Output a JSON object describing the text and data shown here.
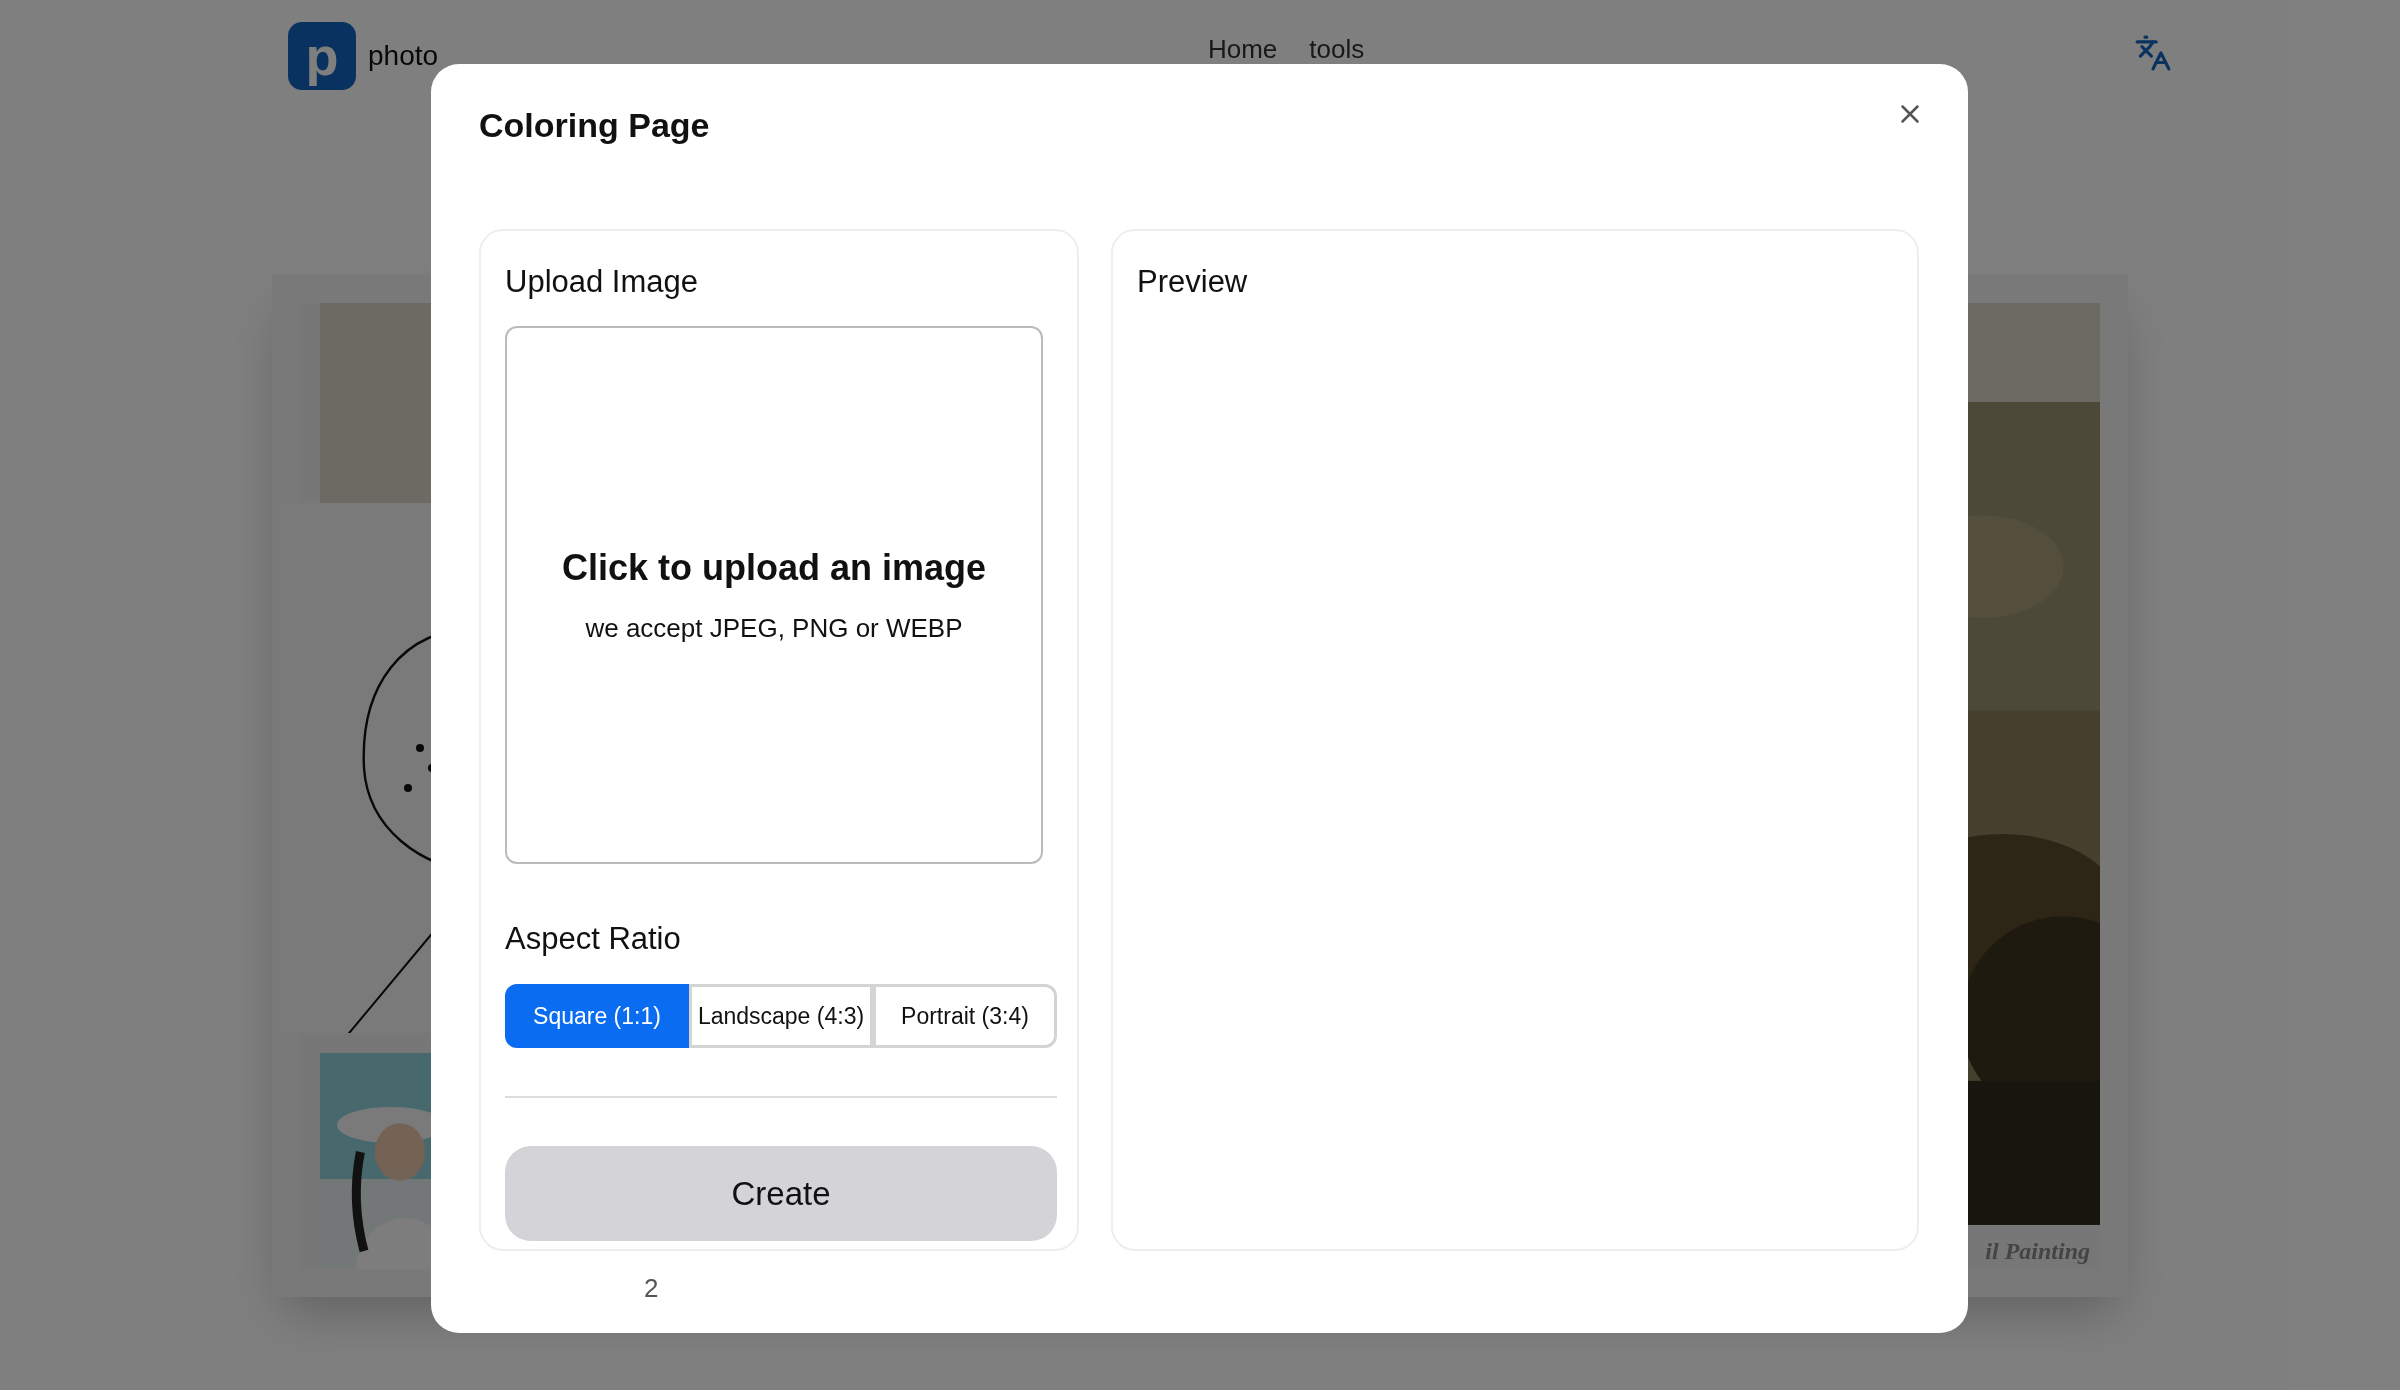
{
  "header": {
    "logo_letter": "p",
    "site_name": "photo",
    "nav": [
      "Home",
      "tools"
    ]
  },
  "gallery": {
    "caption": "il Painting"
  },
  "dialog": {
    "title": "Coloring Page",
    "upload": {
      "heading": "Upload Image",
      "prompt": "Click to upload an image",
      "hint": "we accept JPEG, PNG or WEBP"
    },
    "aspect_ratio": {
      "label": "Aspect Ratio",
      "options": [
        {
          "label": "Square (1:1)",
          "selected": true
        },
        {
          "label": "Landscape (4:3)",
          "selected": false
        },
        {
          "label": "Portrait (3:4)",
          "selected": false
        }
      ]
    },
    "create_button": "Create",
    "preview": {
      "heading": "Preview"
    },
    "page_number": "2"
  }
}
